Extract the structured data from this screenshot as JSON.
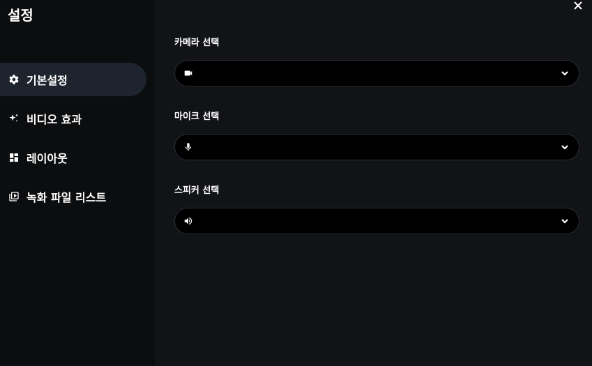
{
  "sidebar": {
    "title": "설정",
    "items": [
      {
        "label": "기본설정",
        "icon": "gear-icon",
        "active": true
      },
      {
        "label": "비디오 효과",
        "icon": "sparkle-icon",
        "active": false
      },
      {
        "label": "레이아웃",
        "icon": "dashboard-icon",
        "active": false
      },
      {
        "label": "녹화 파일 리스트",
        "icon": "video-library-icon",
        "active": false
      }
    ]
  },
  "main": {
    "camera": {
      "label": "카메라 선택",
      "value": "",
      "icon": "video-camera-icon"
    },
    "mic": {
      "label": "마이크 선택",
      "value": "",
      "icon": "microphone-icon"
    },
    "speaker": {
      "label": "스피커 선택",
      "value": "",
      "icon": "speaker-icon"
    }
  },
  "colors": {
    "sidebar_bg": "#0c0d0f",
    "main_bg": "#121316",
    "active_item_bg": "#1d242d",
    "select_bg": "#000000"
  }
}
